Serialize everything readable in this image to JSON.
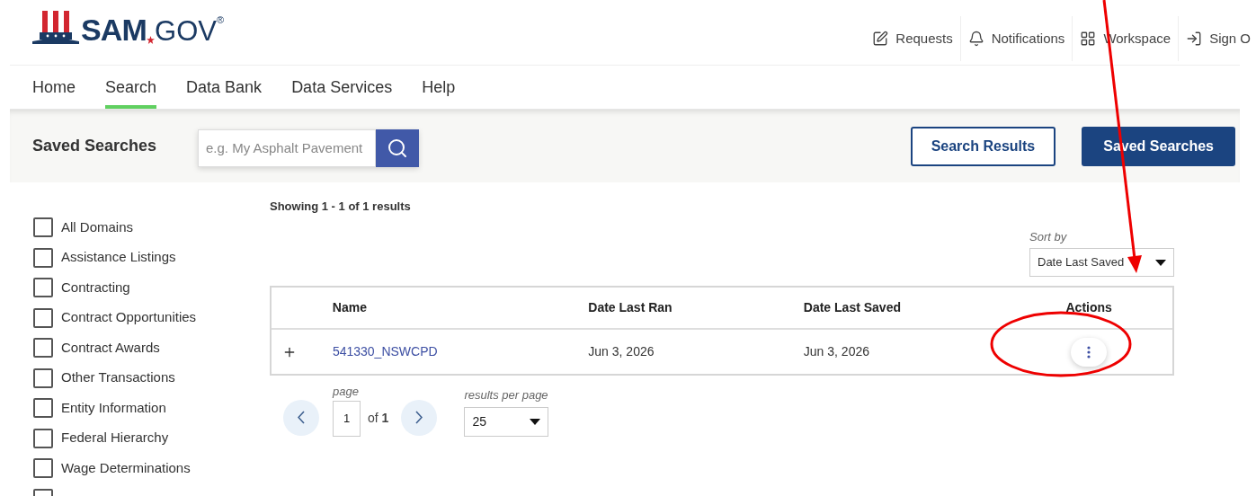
{
  "header": {
    "logo": {
      "main": "SAM",
      "suffix": "GOV",
      "mark": "®"
    },
    "utility_links": [
      {
        "label": "Requests",
        "kind": "edit"
      },
      {
        "label": "Notifications",
        "kind": "bell"
      },
      {
        "label": "Workspace",
        "kind": "grid"
      },
      {
        "label": "Sign O",
        "kind": "signout"
      }
    ]
  },
  "nav": [
    {
      "label": "Home",
      "selected": false
    },
    {
      "label": "Search",
      "selected": true
    },
    {
      "label": "Data Bank",
      "selected": false
    },
    {
      "label": "Data Services",
      "selected": false
    },
    {
      "label": "Help",
      "selected": false
    }
  ],
  "toolbar": {
    "title": "Saved Searches",
    "search": {
      "placeholder": "e.g. My Asphalt Pavement"
    },
    "view_buttons": [
      {
        "label": "Search Results",
        "selected": false
      },
      {
        "label": "Saved Searches",
        "selected": true
      }
    ]
  },
  "filters": [
    {
      "label": "All Domains",
      "checked": false
    },
    {
      "label": "Assistance Listings",
      "checked": false
    },
    {
      "label": "Contracting",
      "checked": false
    },
    {
      "label": "Contract Opportunities",
      "checked": false
    },
    {
      "label": "Contract Awards",
      "checked": false
    },
    {
      "label": "Other Transactions",
      "checked": false
    },
    {
      "label": "Entity Information",
      "checked": false
    },
    {
      "label": "Federal Hierarchy",
      "checked": false
    },
    {
      "label": "Wage Determinations",
      "checked": false
    },
    {
      "checked": false
    }
  ],
  "results": {
    "summary": "Showing 1 - 1 of 1 results",
    "sort": {
      "label": "Sort by",
      "value": "Date Last Saved"
    },
    "table": {
      "columns": [
        "Name",
        "Date Last Ran",
        "Date Last Saved",
        "Actions"
      ],
      "rows": [
        {
          "name": "541330_NSWCPD",
          "date_last_ran": "Jun 3, 2026",
          "date_last_saved": "Jun 3, 2026",
          "expanded": false
        }
      ]
    },
    "pagination": {
      "page_label": "page",
      "page": "1",
      "of": "of",
      "total": "1",
      "per_page_label": "results per page",
      "per_page": "25"
    }
  }
}
